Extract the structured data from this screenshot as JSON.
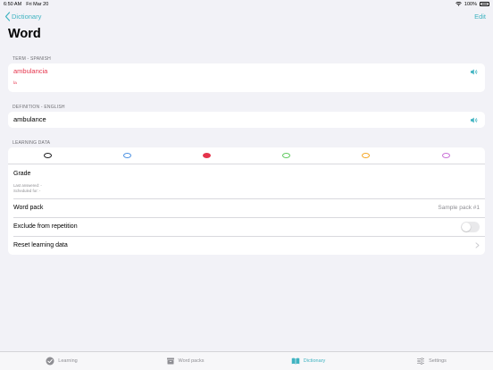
{
  "status_bar": {
    "time": "6:50 AM",
    "date": "Fri Mar 20",
    "battery": "100%"
  },
  "nav": {
    "back_label": "Dictionary",
    "edit_label": "Edit",
    "title": "Word"
  },
  "term_section": {
    "header": "TERM - SPANISH",
    "word": "ambulancia",
    "article": "la"
  },
  "definition_section": {
    "header": "DEFINITION - ENGLISH",
    "word": "ambulance"
  },
  "learning_section": {
    "header": "LEARNING DATA",
    "grade_colors": [
      "#1c1c1e",
      "#4a90e2",
      "#e5344c",
      "#5cc95c",
      "#f5a623",
      "#c86dd7"
    ],
    "selected_grade": 2,
    "grade_title": "Grade",
    "last_answered": "Last answered: -",
    "scheduled_for": "Scheduled for: -",
    "word_pack_label": "Word pack",
    "word_pack_value": "Sample pack #1",
    "exclude_label": "Exclude from repetition",
    "exclude_on": false,
    "reset_label": "Reset learning data"
  },
  "tabs": [
    {
      "label": "Learning",
      "icon": "checkmark-circle-icon",
      "active": false
    },
    {
      "label": "Word packs",
      "icon": "archive-box-icon",
      "active": false
    },
    {
      "label": "Dictionary",
      "icon": "book-icon",
      "active": true
    },
    {
      "label": "Settings",
      "icon": "sliders-icon",
      "active": false
    }
  ],
  "colors": {
    "accent": "#3fb3c1",
    "term": "#e5344c"
  }
}
